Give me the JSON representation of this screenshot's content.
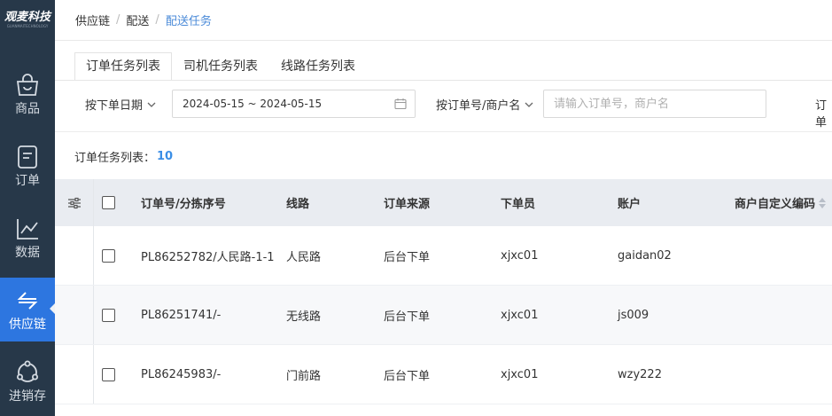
{
  "sidebar": {
    "logo": "观麦科技",
    "logo_sub": "GUANMAITECHNOLOGY",
    "items": [
      {
        "label": "商品",
        "icon": "bag-icon"
      },
      {
        "label": "订单",
        "icon": "document-icon"
      },
      {
        "label": "数据",
        "icon": "line-chart-icon"
      },
      {
        "label": "供应链",
        "icon": "swap-arrows-icon",
        "active": true
      },
      {
        "label": "进销存",
        "icon": "cycle-icon"
      }
    ]
  },
  "breadcrumb": [
    "供应链",
    "配送",
    "配送任务"
  ],
  "tabs": [
    "订单任务列表",
    "司机任务列表",
    "线路任务列表"
  ],
  "filters": {
    "date_type": "按下单日期",
    "date_range": "2024-05-15 ~ 2024-05-15",
    "search_type": "按订单号/商户名",
    "search_placeholder": "请输入订单号，商户名",
    "extra_label": "订单"
  },
  "count": {
    "label": "订单任务列表：",
    "value": "10"
  },
  "table": {
    "columns": [
      "订单号/分拣序号",
      "线路",
      "订单来源",
      "下单员",
      "账户",
      "商户自定义编码"
    ],
    "rows": [
      {
        "order": "PL86252782/人民路-1-1",
        "route": "人民路",
        "source": "后台下单",
        "operator": "xjxc01",
        "account": "gaidan02",
        "code": ""
      },
      {
        "order": "PL86251741/-",
        "route": "无线路",
        "source": "后台下单",
        "operator": "xjxc01",
        "account": "js009",
        "code": ""
      },
      {
        "order": "PL86245983/-",
        "route": "门前路",
        "source": "后台下单",
        "operator": "xjxc01",
        "account": "wzy222",
        "code": ""
      }
    ]
  }
}
